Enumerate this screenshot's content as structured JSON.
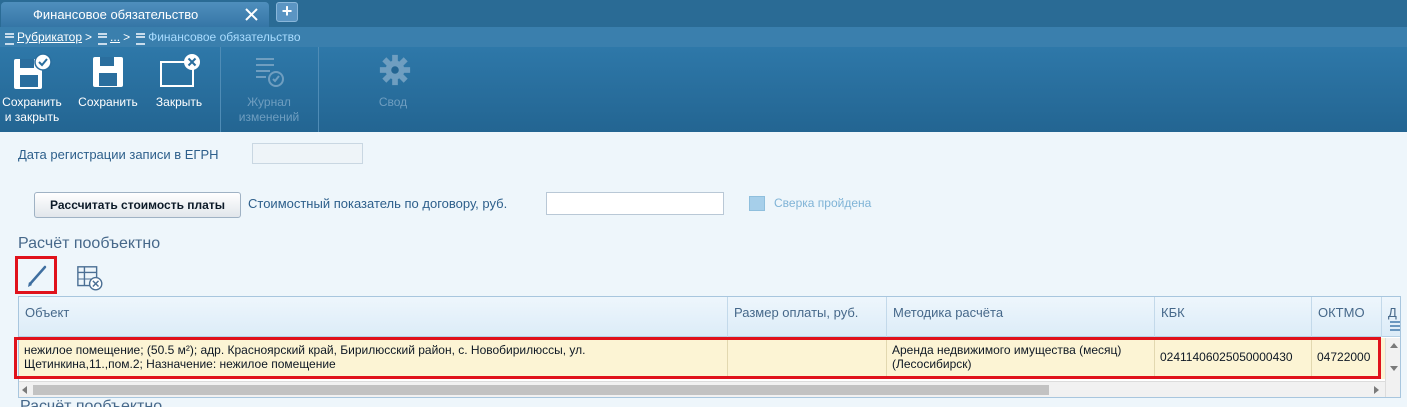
{
  "tab": {
    "title": "Финансовое обязательство",
    "add_label": "+"
  },
  "breadcrumb": {
    "root": "Рубрикатор",
    "sep": ">",
    "middle": "...",
    "current": "Финансовое обязательство"
  },
  "toolbar": {
    "save_close_line1": "Сохранить",
    "save_close_line2": "и закрыть",
    "save": "Сохранить",
    "close": "Закрыть",
    "journal_line1": "Журнал",
    "journal_line2": "изменений",
    "summary": "Свод"
  },
  "form": {
    "reg_date_label": "Дата регистрации записи в ЕГРН",
    "reg_date_value": "",
    "calc_button": "Рассчитать стоимость платы",
    "cost_label": "Стоимостный показатель по договору, руб.",
    "cost_value": "",
    "check_label": "Сверка пройдена"
  },
  "section": {
    "title": "Расчёт пообъектно",
    "title_below": "Расчёт пообъектно"
  },
  "grid": {
    "columns": [
      "Объект",
      "Размер оплаты, руб.",
      "Методика расчёта",
      "КБК",
      "ОКТМО",
      "Д"
    ],
    "rows": [
      {
        "object": "нежилое помещение; (50.5 м²); адр. Красноярский край, Бирилюсский район, с. Новобирилюссы, ул. Щетинкина,11.,пом.2; Назначение: нежилое помещение",
        "payment": "",
        "method": "Аренда недвижимого имущества (месяц) (Лесосибирск)",
        "kbk": "02411406025050000430",
        "oktmo": "04722000"
      }
    ]
  },
  "colors": {
    "accent_red": "#e0121b",
    "toolbar": "#236592",
    "row_highlight": "#fcf4d4"
  }
}
